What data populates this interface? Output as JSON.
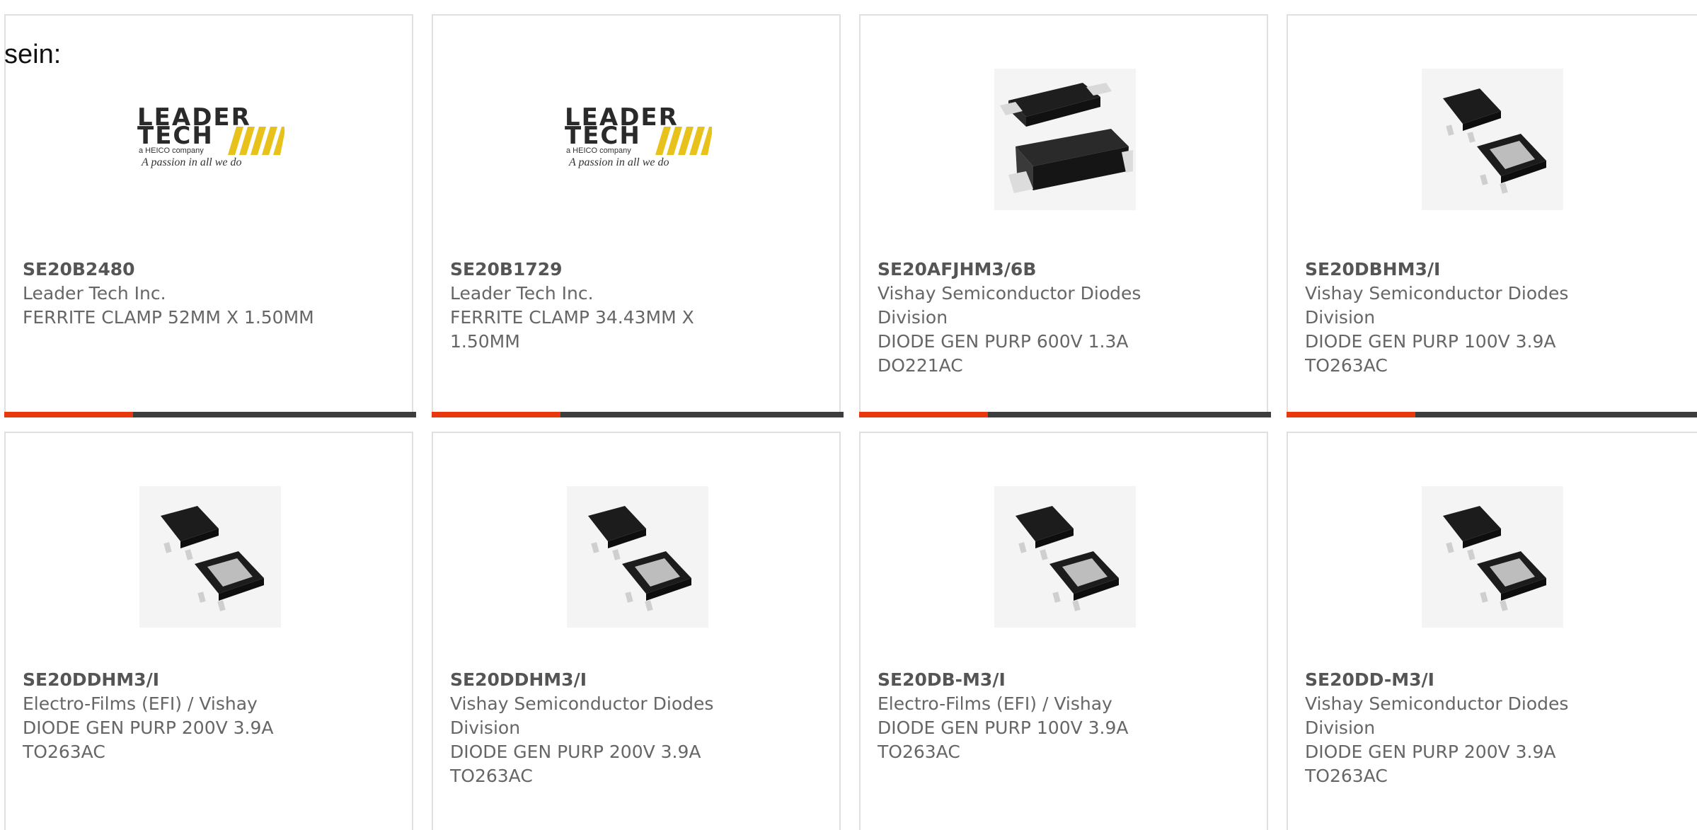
{
  "heading": "sein:",
  "colors": {
    "accent": "#e8380d",
    "bar": "#3d3d3d",
    "border": "#e0e0e0",
    "text": "#666666"
  },
  "products": [
    {
      "part_number": "SE20B2480",
      "manufacturer": "Leader Tech Inc.",
      "description": "FERRITE CLAMP 52MM X 1.50MM",
      "image": "leader-tech-logo",
      "logo": {
        "line1": "LEADER",
        "line2": "TECH",
        "tag": "a HEICO company",
        "slogan": "A passion in all we do"
      }
    },
    {
      "part_number": "SE20B1729",
      "manufacturer": "Leader Tech Inc.",
      "description": "FERRITE CLAMP 34.43MM X 1.50MM",
      "image": "leader-tech-logo",
      "logo": {
        "line1": "LEADER",
        "line2": "TECH",
        "tag": "a HEICO company",
        "slogan": "A passion in all we do"
      }
    },
    {
      "part_number": "SE20AFJHM3/6B",
      "manufacturer": "Vishay Semiconductor Diodes Division",
      "description": "DIODE GEN PURP 600V 1.3A DO221AC",
      "image": "do221ac-package"
    },
    {
      "part_number": "SE20DBHM3/I",
      "manufacturer": "Vishay Semiconductor Diodes Division",
      "description": "DIODE GEN PURP 100V 3.9A TO263AC",
      "image": "to263ac-package"
    },
    {
      "part_number": "SE20DDHM3/I",
      "manufacturer": "Electro-Films (EFI) / Vishay",
      "description": "DIODE GEN PURP 200V 3.9A TO263AC",
      "image": "to263ac-package"
    },
    {
      "part_number": "SE20DDHM3/I",
      "manufacturer": "Vishay Semiconductor Diodes Division",
      "description": "DIODE GEN PURP 200V 3.9A TO263AC",
      "image": "to263ac-package"
    },
    {
      "part_number": "SE20DB-M3/I",
      "manufacturer": "Electro-Films (EFI) / Vishay",
      "description": "DIODE GEN PURP 100V 3.9A TO263AC",
      "image": "to263ac-package"
    },
    {
      "part_number": "SE20DD-M3/I",
      "manufacturer": "Vishay Semiconductor Diodes Division",
      "description": "DIODE GEN PURP 200V 3.9A TO263AC",
      "image": "to263ac-package"
    }
  ]
}
